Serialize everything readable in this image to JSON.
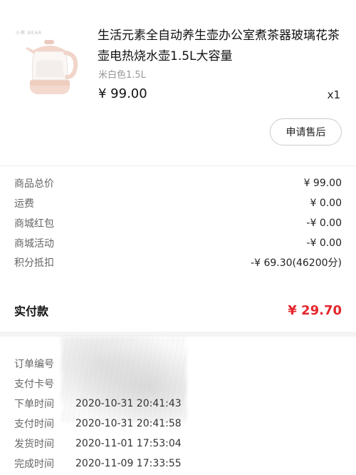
{
  "product": {
    "brand_tag": "小熊 BEAR",
    "title": "生活元素全自动养生壶办公室煮茶器玻璃花茶壶电热烧水壶1.5L大容量",
    "spec": "米白色1.5L",
    "price": "¥ 99.00",
    "quantity": "x1",
    "after_sale_label": "申请售后"
  },
  "price_breakdown": [
    {
      "label": "商品总价",
      "value": "¥ 99.00"
    },
    {
      "label": "运费",
      "value": "¥ 0.00"
    },
    {
      "label": "商城红包",
      "value": "-¥ 0.00"
    },
    {
      "label": "商城活动",
      "value": "-¥ 0.00"
    },
    {
      "label": "积分抵扣",
      "value": "-¥ 69.30(46200分)"
    }
  ],
  "payment": {
    "label": "实付款",
    "value": "¥ 29.70",
    "accent_color": "#e4262c"
  },
  "order_info": [
    {
      "label": "订单编号",
      "value": ""
    },
    {
      "label": "支付卡号",
      "value": ""
    },
    {
      "label": "下单时间",
      "value": "2020-10-31 20:41:43"
    },
    {
      "label": "支付时间",
      "value": "2020-10-31 20:41:58"
    },
    {
      "label": "发货时间",
      "value": "2020-11-01 17:53:04"
    },
    {
      "label": "完成时间",
      "value": "2020-11-09 17:33:55"
    }
  ]
}
